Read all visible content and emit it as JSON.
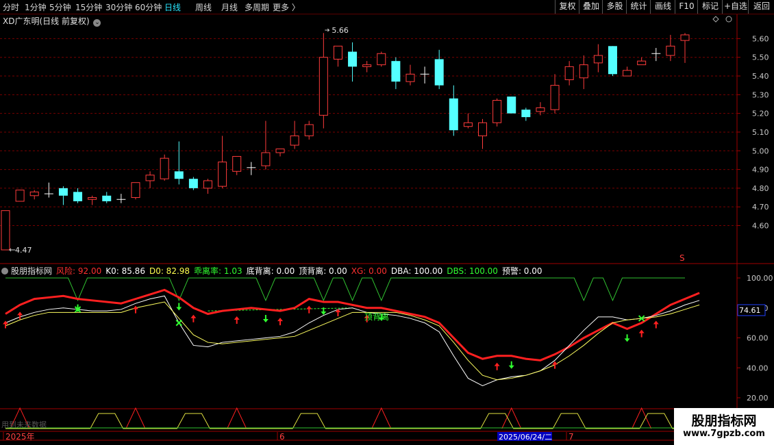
{
  "toolbar": {
    "periods": [
      "分时",
      "1分钟",
      "5分钟",
      "15分钟",
      "30分钟",
      "60分钟",
      "日线",
      "周线",
      "月线",
      "多周期",
      "更多 〉"
    ],
    "active_period": "日线",
    "right_buttons": [
      "复权",
      "叠加",
      "多股",
      "统计",
      "画线",
      "F10",
      "标记",
      "+自选",
      "返回"
    ]
  },
  "price_panel": {
    "title": "XD广东明(日线 前复权)",
    "high_label": "5.66",
    "low_label": "4.47",
    "marker": "S"
  },
  "indicator_panel": {
    "name": "股朋指标网",
    "readouts": [
      {
        "label": "风险: 92.00",
        "color": "#ff3030"
      },
      {
        "label": "K0: 85.86",
        "color": "#ffffff"
      },
      {
        "label": "D0: 82.98",
        "color": "#ffff50"
      },
      {
        "label": "乖离率: 1.03",
        "color": "#30ff30"
      },
      {
        "label": "底背离: 0.00",
        "color": "#ffffff"
      },
      {
        "label": "顶背离: 0.00",
        "color": "#ffffff"
      },
      {
        "label": "XG: 0.00",
        "color": "#ff3030"
      },
      {
        "label": "DBA: 100.00",
        "color": "#ffffff"
      },
      {
        "label": "DBS: 100.00",
        "color": "#30ff30"
      },
      {
        "label": "预警: 0.00",
        "color": "#ffffff"
      }
    ],
    "annotation": "顶背离",
    "current_value": "74.61"
  },
  "bottom_strip": {
    "faded_text": "用到未来数据"
  },
  "date_axis": {
    "year_label": "2025年",
    "month_labels": [
      "6",
      "7"
    ],
    "cursor_date": "2025/06/24/二"
  },
  "brand": {
    "name": "股朋指标网",
    "url": "www.7gpzb.com"
  },
  "colors": {
    "up": "#ff3c3c",
    "down": "#54ffff",
    "grid": "#7a0000",
    "axis_text": "#c8c8c8"
  },
  "chart_data": [
    {
      "type": "candlestick",
      "y_ticks": [
        4.6,
        4.7,
        4.8,
        4.9,
        5.0,
        5.1,
        5.2,
        5.3,
        5.4,
        5.5,
        5.6
      ],
      "ylim": [
        4.47,
        5.66
      ],
      "candles": [
        {
          "o": 4.47,
          "h": 4.68,
          "l": 4.47,
          "c": 4.68
        },
        {
          "o": 4.73,
          "h": 4.79,
          "l": 4.73,
          "c": 4.79
        },
        {
          "o": 4.76,
          "h": 4.79,
          "l": 4.74,
          "c": 4.78
        },
        {
          "o": 4.77,
          "h": 4.83,
          "l": 4.75,
          "c": 4.77
        },
        {
          "o": 4.8,
          "h": 4.81,
          "l": 4.71,
          "c": 4.76
        },
        {
          "o": 4.78,
          "h": 4.8,
          "l": 4.72,
          "c": 4.73
        },
        {
          "o": 4.74,
          "h": 4.76,
          "l": 4.71,
          "c": 4.75
        },
        {
          "o": 4.76,
          "h": 4.78,
          "l": 4.72,
          "c": 4.73
        },
        {
          "o": 4.74,
          "h": 4.77,
          "l": 4.72,
          "c": 4.74
        },
        {
          "o": 4.75,
          "h": 4.83,
          "l": 4.74,
          "c": 4.83
        },
        {
          "o": 4.84,
          "h": 4.89,
          "l": 4.8,
          "c": 4.87
        },
        {
          "o": 4.85,
          "h": 4.98,
          "l": 4.84,
          "c": 4.96
        },
        {
          "o": 4.89,
          "h": 5.05,
          "l": 4.82,
          "c": 4.85
        },
        {
          "o": 4.85,
          "h": 4.86,
          "l": 4.79,
          "c": 4.8
        },
        {
          "o": 4.8,
          "h": 4.85,
          "l": 4.77,
          "c": 4.84
        },
        {
          "o": 4.81,
          "h": 5.08,
          "l": 4.8,
          "c": 4.94
        },
        {
          "o": 4.89,
          "h": 4.97,
          "l": 4.87,
          "c": 4.97
        },
        {
          "o": 4.91,
          "h": 4.94,
          "l": 4.87,
          "c": 4.91
        },
        {
          "o": 4.92,
          "h": 5.16,
          "l": 4.9,
          "c": 4.99
        },
        {
          "o": 4.99,
          "h": 5.01,
          "l": 4.97,
          "c": 5.01
        },
        {
          "o": 5.03,
          "h": 5.16,
          "l": 5.01,
          "c": 5.08
        },
        {
          "o": 5.08,
          "h": 5.16,
          "l": 5.06,
          "c": 5.14
        },
        {
          "o": 5.19,
          "h": 5.63,
          "l": 5.12,
          "c": 5.5
        },
        {
          "o": 5.49,
          "h": 5.56,
          "l": 5.45,
          "c": 5.56
        },
        {
          "o": 5.53,
          "h": 5.58,
          "l": 5.37,
          "c": 5.45
        },
        {
          "o": 5.45,
          "h": 5.48,
          "l": 5.42,
          "c": 5.46
        },
        {
          "o": 5.46,
          "h": 5.53,
          "l": 5.45,
          "c": 5.52
        },
        {
          "o": 5.48,
          "h": 5.5,
          "l": 5.33,
          "c": 5.37
        },
        {
          "o": 5.37,
          "h": 5.46,
          "l": 5.35,
          "c": 5.41
        },
        {
          "o": 5.41,
          "h": 5.45,
          "l": 5.36,
          "c": 5.41
        },
        {
          "o": 5.49,
          "h": 5.54,
          "l": 5.33,
          "c": 5.35
        },
        {
          "o": 5.28,
          "h": 5.35,
          "l": 5.08,
          "c": 5.11
        },
        {
          "o": 5.13,
          "h": 5.2,
          "l": 5.12,
          "c": 5.15
        },
        {
          "o": 5.08,
          "h": 5.17,
          "l": 5.01,
          "c": 5.15
        },
        {
          "o": 5.15,
          "h": 5.28,
          "l": 5.13,
          "c": 5.27
        },
        {
          "o": 5.29,
          "h": 5.29,
          "l": 5.2,
          "c": 5.2
        },
        {
          "o": 5.22,
          "h": 5.23,
          "l": 5.16,
          "c": 5.18
        },
        {
          "o": 5.21,
          "h": 5.26,
          "l": 5.19,
          "c": 5.23
        },
        {
          "o": 5.22,
          "h": 5.41,
          "l": 5.2,
          "c": 5.35
        },
        {
          "o": 5.38,
          "h": 5.48,
          "l": 5.35,
          "c": 5.45
        },
        {
          "o": 5.39,
          "h": 5.51,
          "l": 5.33,
          "c": 5.46
        },
        {
          "o": 5.47,
          "h": 5.57,
          "l": 5.42,
          "c": 5.51
        },
        {
          "o": 5.56,
          "h": 5.56,
          "l": 5.4,
          "c": 5.41
        },
        {
          "o": 5.4,
          "h": 5.45,
          "l": 5.4,
          "c": 5.43
        },
        {
          "o": 5.46,
          "h": 5.5,
          "l": 5.46,
          "c": 5.48
        },
        {
          "o": 5.52,
          "h": 5.55,
          "l": 5.48,
          "c": 5.52
        },
        {
          "o": 5.51,
          "h": 5.62,
          "l": 5.48,
          "c": 5.56
        },
        {
          "o": 5.59,
          "h": 5.63,
          "l": 5.47,
          "c": 5.62
        }
      ]
    },
    {
      "type": "line",
      "y_ticks": [
        20,
        40,
        60,
        80,
        100
      ],
      "ylim": [
        12,
        104
      ],
      "series": [
        {
          "key": "risk",
          "color": "#ff2020",
          "values": [
            76,
            82,
            86,
            87,
            88,
            86,
            85,
            84,
            83,
            86,
            89,
            92,
            87,
            80,
            76,
            78,
            79,
            80,
            79,
            78,
            80,
            86,
            84,
            84,
            82,
            80,
            80,
            78,
            76,
            74,
            70,
            60,
            50,
            46,
            48,
            48,
            46,
            45,
            49,
            54,
            60,
            65,
            70,
            66,
            70,
            76,
            82,
            86,
            90
          ]
        },
        {
          "key": "k",
          "color": "#ffffff",
          "values": [
            70,
            74,
            77,
            79,
            80,
            79,
            78,
            78,
            79,
            83,
            86,
            88,
            70,
            55,
            54,
            57,
            58,
            59,
            60,
            61,
            64,
            70,
            75,
            79,
            80,
            77,
            76,
            75,
            73,
            70,
            64,
            48,
            33,
            28,
            32,
            34,
            35,
            38,
            45,
            55,
            65,
            74,
            74,
            72,
            73,
            75,
            78,
            82,
            85
          ]
        },
        {
          "key": "d",
          "color": "#ffff60",
          "values": [
            68,
            72,
            75,
            77,
            77,
            77,
            77,
            77,
            77,
            80,
            82,
            84,
            73,
            62,
            57,
            56,
            57,
            58,
            59,
            60,
            61,
            65,
            69,
            73,
            77,
            77,
            77,
            77,
            75,
            72,
            68,
            57,
            45,
            35,
            32,
            33,
            35,
            38,
            42,
            48,
            55,
            63,
            70,
            72,
            73,
            74,
            76,
            79,
            82
          ]
        }
      ]
    }
  ]
}
